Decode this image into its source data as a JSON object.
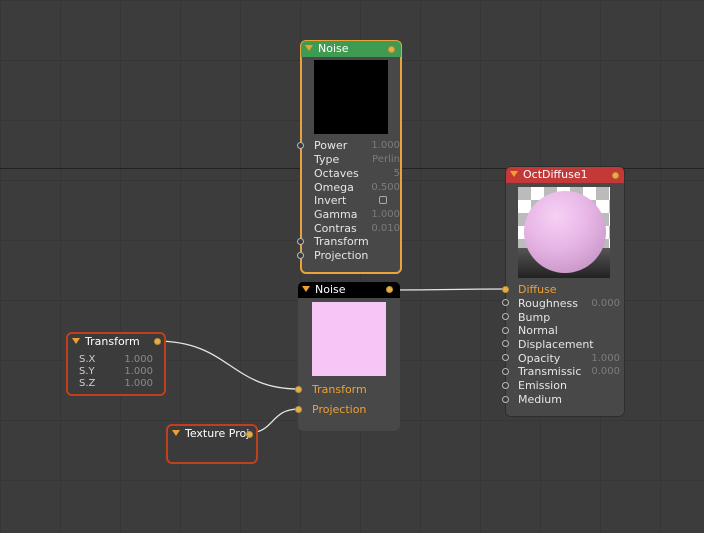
{
  "nodes": {
    "noise_top": {
      "title": "Noise",
      "params": [
        {
          "label": "Power",
          "value": "1.000"
        },
        {
          "label": "Type",
          "value": "Perlin"
        },
        {
          "label": "Octaves",
          "value": "5"
        },
        {
          "label": "Omega",
          "value": "0.500"
        },
        {
          "label": "Invert",
          "value": ""
        },
        {
          "label": "Gamma",
          "value": "1.000"
        },
        {
          "label": "Contras",
          "value": "0.010"
        }
      ],
      "inputs": [
        "Transform",
        "Projection"
      ]
    },
    "noise_bottom": {
      "title": "Noise",
      "inputs": [
        "Transform",
        "Projection"
      ]
    },
    "oct_diffuse": {
      "title": "OctDiffuse1",
      "inputs": [
        {
          "label": "Diffuse",
          "value": ""
        },
        {
          "label": "Roughness",
          "value": "0.000"
        },
        {
          "label": "Bump",
          "value": ""
        },
        {
          "label": "Normal",
          "value": ""
        },
        {
          "label": "Displacement",
          "value": ""
        },
        {
          "label": "Opacity",
          "value": "1.000"
        },
        {
          "label": "Transmissic",
          "value": "0.000"
        },
        {
          "label": "Emission",
          "value": ""
        },
        {
          "label": "Medium",
          "value": ""
        }
      ]
    },
    "transform": {
      "title": "Transform",
      "params": [
        {
          "label": "S.X",
          "value": "1.000"
        },
        {
          "label": "S.Y",
          "value": "1.000"
        },
        {
          "label": "S.Z",
          "value": "1.000"
        }
      ]
    },
    "texture_proj": {
      "title": "Texture Proj"
    }
  },
  "colors": {
    "background": "#3c3c3c",
    "selected_border": "#e8a43a",
    "noise_header": "#3f9a52",
    "diffuse_header": "#c43838",
    "error_border": "#c0401e",
    "connected_pin": "#e0b050",
    "wire": "#e6e6e6"
  },
  "icons": {
    "collapse": "triangle-down-icon",
    "output": "pin-dot-icon",
    "checkbox": "checkbox-icon"
  }
}
